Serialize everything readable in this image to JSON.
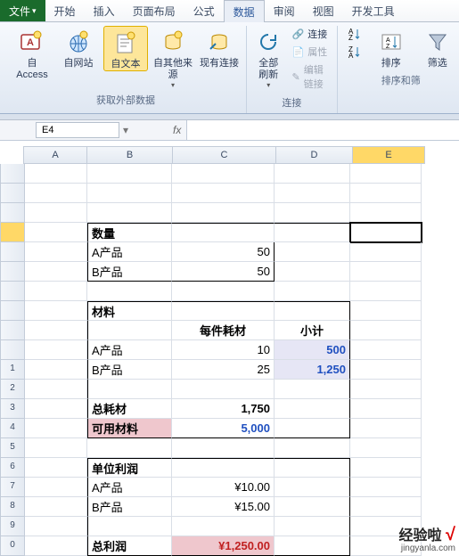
{
  "tabs": {
    "file": "文件",
    "home": "开始",
    "insert": "插入",
    "layout": "页面布局",
    "formula": "公式",
    "data": "数据",
    "review": "审阅",
    "view": "视图",
    "dev": "开发工具"
  },
  "ribbon": {
    "group1": {
      "label": "获取外部数据",
      "access": "自 Access",
      "web": "自网站",
      "text": "自文本",
      "other": "自其他来源",
      "existing": "现有连接"
    },
    "group2": {
      "label": "连接",
      "refresh": "全部刷新",
      "conn": "连接",
      "prop": "属性",
      "edit": "编辑链接"
    },
    "group3": {
      "label": "排序和筛",
      "sort": "排序",
      "filter": "筛选"
    }
  },
  "formula": {
    "cell": "E4",
    "fx": "fx"
  },
  "cols": {
    "A": "A",
    "B": "B",
    "C": "C",
    "D": "D",
    "E": "E"
  },
  "t": {
    "qty": "数量",
    "prodA": "A产品",
    "prodB": "B产品",
    "qtyA": "50",
    "qtyB": "50",
    "mat": "材料",
    "percost": "每件耗材",
    "subtotal": "小计",
    "matA": "10",
    "matB": "25",
    "subA": "500",
    "subB": "1,250",
    "totmat": "总耗材",
    "totmatV": "1,750",
    "avail": "可用材料",
    "availV": "5,000",
    "uprofit": "单位利润",
    "upA": "¥10.00",
    "upB": "¥15.00",
    "tprofit": "总利润",
    "tprofitV": "¥1,250.00"
  },
  "wm": {
    "main": "经验啦",
    "sub": "jingyanla.com"
  },
  "chart_data": {
    "type": "table",
    "sections": [
      {
        "title": "数量",
        "rows": [
          [
            "A产品",
            50
          ],
          [
            "B产品",
            50
          ]
        ]
      },
      {
        "title": "材料",
        "columns": [
          "",
          "每件耗材",
          "小计"
        ],
        "rows": [
          [
            "A产品",
            10,
            500
          ],
          [
            "B产品",
            25,
            1250
          ],
          [
            "总耗材",
            1750,
            null
          ],
          [
            "可用材料",
            5000,
            null
          ]
        ]
      },
      {
        "title": "单位利润",
        "rows": [
          [
            "A产品",
            "¥10.00"
          ],
          [
            "B产品",
            "¥15.00"
          ],
          [
            "总利润",
            "¥1,250.00"
          ]
        ]
      }
    ]
  }
}
